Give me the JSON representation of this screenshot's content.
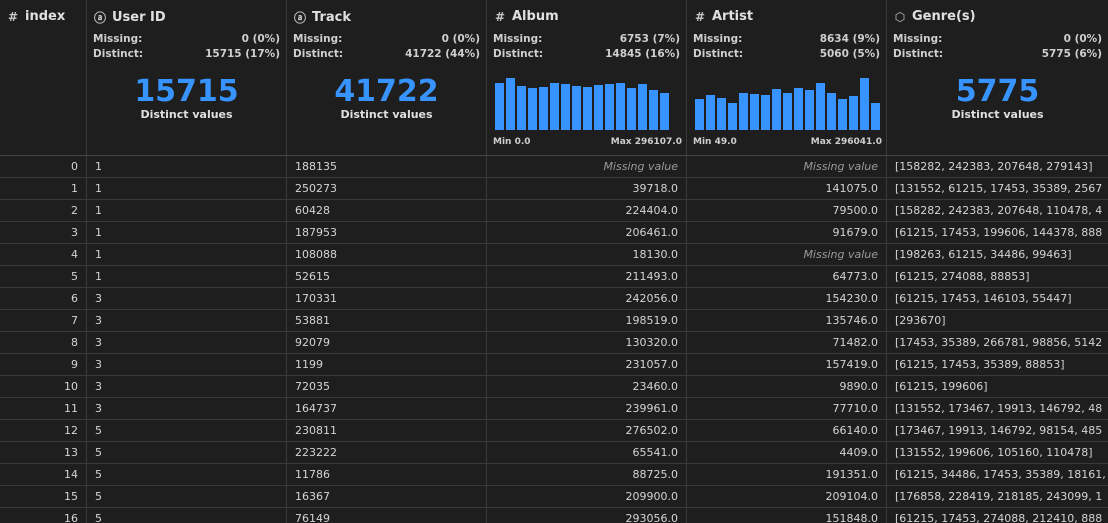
{
  "columns": [
    {
      "key": "index",
      "title": "index",
      "icon_glyph": "#",
      "icon_name": "hash-icon"
    },
    {
      "key": "user_id",
      "title": "User ID",
      "icon_glyph": "ⓐ",
      "icon_name": "text-type-icon",
      "missing": "0 (0%)",
      "distinct": "15715 (17%)",
      "distinct_value": "15715",
      "distinct_label": "Distinct values"
    },
    {
      "key": "track",
      "title": "Track",
      "icon_glyph": "ⓐ",
      "icon_name": "text-type-icon",
      "missing": "0 (0%)",
      "distinct": "41722 (44%)",
      "distinct_value": "41722",
      "distinct_label": "Distinct values"
    },
    {
      "key": "album",
      "title": "Album",
      "icon_glyph": "#",
      "icon_name": "hash-icon",
      "missing": "6753 (7%)",
      "distinct": "14845 (16%)",
      "hist": [
        0.9,
        1.0,
        0.85,
        0.8,
        0.82,
        0.9,
        0.88,
        0.85,
        0.82,
        0.86,
        0.88,
        0.9,
        0.8,
        0.88,
        0.76,
        0.72
      ],
      "min": "Min 0.0",
      "max": "Max 296107.0"
    },
    {
      "key": "artist",
      "title": "Artist",
      "icon_glyph": "#",
      "icon_name": "hash-icon",
      "missing": "8634 (9%)",
      "distinct": "5060 (5%)",
      "hist": [
        0.6,
        0.68,
        0.62,
        0.52,
        0.72,
        0.7,
        0.68,
        0.78,
        0.72,
        0.8,
        0.76,
        0.9,
        0.72,
        0.6,
        0.66,
        1.0,
        0.52
      ],
      "min": "Min 49.0",
      "max": "Max 296041.0"
    },
    {
      "key": "genres",
      "title": "Genre(s)",
      "icon_glyph": "⬡",
      "icon_name": "cube-icon",
      "missing": "0 (0%)",
      "distinct": "5775 (6%)",
      "distinct_value": "5775",
      "distinct_label": "Distinct values"
    }
  ],
  "labels": {
    "missing": "Missing:",
    "distinct": "Distinct:",
    "missing_value": "Missing value"
  },
  "rows": [
    {
      "index": "0",
      "user_id": "1",
      "track": "188135",
      "album": null,
      "artist": null,
      "genres": "[158282, 242383, 207648, 279143]"
    },
    {
      "index": "1",
      "user_id": "1",
      "track": "250273",
      "album": "39718.0",
      "artist": "141075.0",
      "genres": "[131552, 61215, 17453, 35389, 2567"
    },
    {
      "index": "2",
      "user_id": "1",
      "track": "60428",
      "album": "224404.0",
      "artist": "79500.0",
      "genres": "[158282, 242383, 207648, 110478, 4"
    },
    {
      "index": "3",
      "user_id": "1",
      "track": "187953",
      "album": "206461.0",
      "artist": "91679.0",
      "genres": "[61215, 17453, 199606, 144378, 888"
    },
    {
      "index": "4",
      "user_id": "1",
      "track": "108088",
      "album": "18130.0",
      "artist": null,
      "genres": "[198263, 61215, 34486, 99463]"
    },
    {
      "index": "5",
      "user_id": "1",
      "track": "52615",
      "album": "211493.0",
      "artist": "64773.0",
      "genres": "[61215, 274088, 88853]"
    },
    {
      "index": "6",
      "user_id": "3",
      "track": "170331",
      "album": "242056.0",
      "artist": "154230.0",
      "genres": "[61215, 17453, 146103, 55447]"
    },
    {
      "index": "7",
      "user_id": "3",
      "track": "53881",
      "album": "198519.0",
      "artist": "135746.0",
      "genres": "[293670]"
    },
    {
      "index": "8",
      "user_id": "3",
      "track": "92079",
      "album": "130320.0",
      "artist": "71482.0",
      "genres": "[17453, 35389, 266781, 98856, 5142"
    },
    {
      "index": "9",
      "user_id": "3",
      "track": "1199",
      "album": "231057.0",
      "artist": "157419.0",
      "genres": "[61215, 17453, 35389, 88853]"
    },
    {
      "index": "10",
      "user_id": "3",
      "track": "72035",
      "album": "23460.0",
      "artist": "9890.0",
      "genres": "[61215, 199606]"
    },
    {
      "index": "11",
      "user_id": "3",
      "track": "164737",
      "album": "239961.0",
      "artist": "77710.0",
      "genres": "[131552, 173467, 19913, 146792, 48"
    },
    {
      "index": "12",
      "user_id": "5",
      "track": "230811",
      "album": "276502.0",
      "artist": "66140.0",
      "genres": "[173467, 19913, 146792, 98154, 485"
    },
    {
      "index": "13",
      "user_id": "5",
      "track": "223222",
      "album": "65541.0",
      "artist": "4409.0",
      "genres": "[131552, 199606, 105160, 110478]"
    },
    {
      "index": "14",
      "user_id": "5",
      "track": "11786",
      "album": "88725.0",
      "artist": "191351.0",
      "genres": "[61215, 34486, 17453, 35389, 18161,"
    },
    {
      "index": "15",
      "user_id": "5",
      "track": "16367",
      "album": "209900.0",
      "artist": "209104.0",
      "genres": "[176858, 228419, 218185, 243099, 1"
    },
    {
      "index": "16",
      "user_id": "5",
      "track": "76149",
      "album": "293056.0",
      "artist": "151848.0",
      "genres": "[61215, 17453, 274088, 212410, 888"
    }
  ]
}
